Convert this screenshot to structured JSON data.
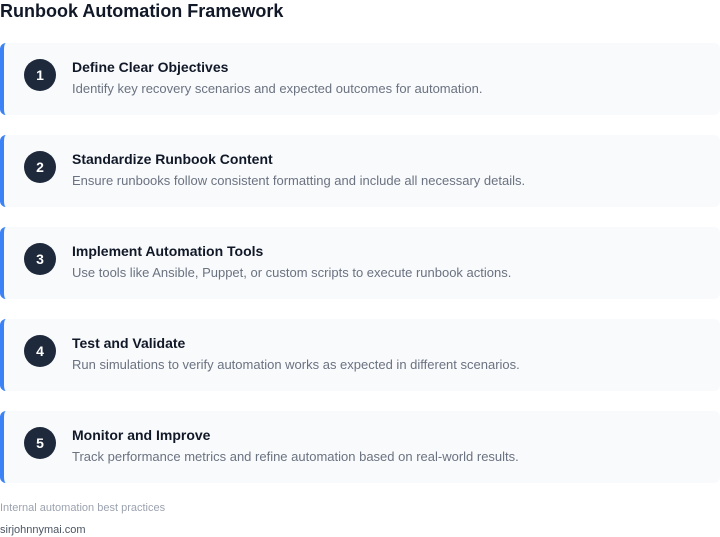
{
  "title": "Runbook Automation Framework",
  "steps": [
    {
      "number": "1",
      "title": "Define Clear Objectives",
      "description": "Identify key recovery scenarios and expected outcomes for automation."
    },
    {
      "number": "2",
      "title": "Standardize Runbook Content",
      "description": "Ensure runbooks follow consistent formatting and include all necessary details."
    },
    {
      "number": "3",
      "title": "Implement Automation Tools",
      "description": "Use tools like Ansible, Puppet, or custom scripts to execute runbook actions."
    },
    {
      "number": "4",
      "title": "Test and Validate",
      "description": "Run simulations to verify automation works as expected in different scenarios."
    },
    {
      "number": "5",
      "title": "Monitor and Improve",
      "description": "Track performance metrics and refine automation based on real-world results."
    }
  ],
  "footer": {
    "note": "Internal automation best practices",
    "source": "sirjohnnymai.com"
  },
  "colors": {
    "accent": "#3b82f6",
    "badge": "#1e293b",
    "card_background": "#f8fafc"
  }
}
